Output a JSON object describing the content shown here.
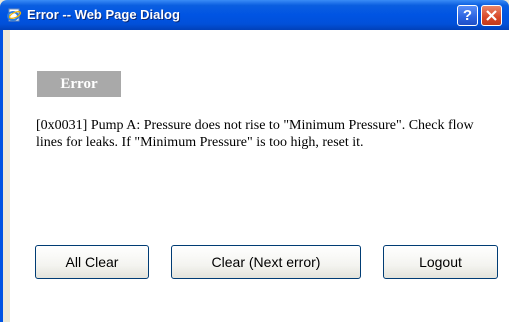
{
  "window": {
    "title": "Error -- Web Page Dialog",
    "help_label": "?"
  },
  "dialog": {
    "badge": "Error",
    "message": "[0x0031] Pump A: Pressure does not rise to \"Minimum Pressure\". Check flow lines for leaks. If \"Minimum Pressure\" is too high, reset it."
  },
  "buttons": {
    "all_clear": "All Clear",
    "clear_next": "Clear (Next error)",
    "logout": "Logout"
  },
  "colors": {
    "titlebar": "#0054E3",
    "badge": "#A9A9A9",
    "close": "#D84828"
  }
}
